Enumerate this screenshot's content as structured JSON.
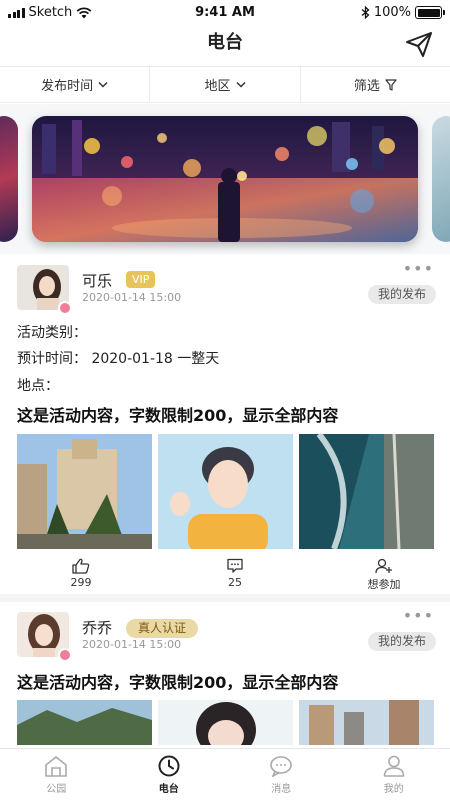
{
  "status_bar": {
    "carrier": "Sketch",
    "time": "9:41 AM",
    "battery": "100%",
    "battery_level": 1.0
  },
  "nav": {
    "title": "电台",
    "send_icon": "paper-plane-icon"
  },
  "filters": [
    {
      "label": "发布时间",
      "icon": "chevron-down-icon"
    },
    {
      "label": "地区",
      "icon": "chevron-down-icon"
    },
    {
      "label": "筛选",
      "icon": "filter-icon"
    }
  ],
  "posts": [
    {
      "name": "可乐",
      "badge": "VIP",
      "time": "2020-01-14  15:00",
      "mine_label": "我的发布",
      "category_label": "活动类别：",
      "expected_time": "预计时间：  2020-01-18 一整天",
      "location_label": "地点：",
      "content": "这是活动内容，字数限制200，显示全部内容",
      "likes": "299",
      "comments": "25",
      "join_label": "想参加"
    },
    {
      "name": "乔乔",
      "badge": "真人认证",
      "time": "2020-01-14  15:00",
      "mine_label": "我的发布",
      "content": "这是活动内容，字数限制200，显示全部内容"
    }
  ],
  "tabs": [
    {
      "label": "公园",
      "icon": "park-icon",
      "active": false
    },
    {
      "label": "电台",
      "icon": "clock-icon",
      "active": true
    },
    {
      "label": "消息",
      "icon": "message-icon",
      "active": false
    },
    {
      "label": "我的",
      "icon": "user-icon",
      "active": false
    }
  ],
  "colors": {
    "vip": "#e6c45a",
    "auth_badge": "#ead8a5",
    "accent_text": "#222222"
  }
}
